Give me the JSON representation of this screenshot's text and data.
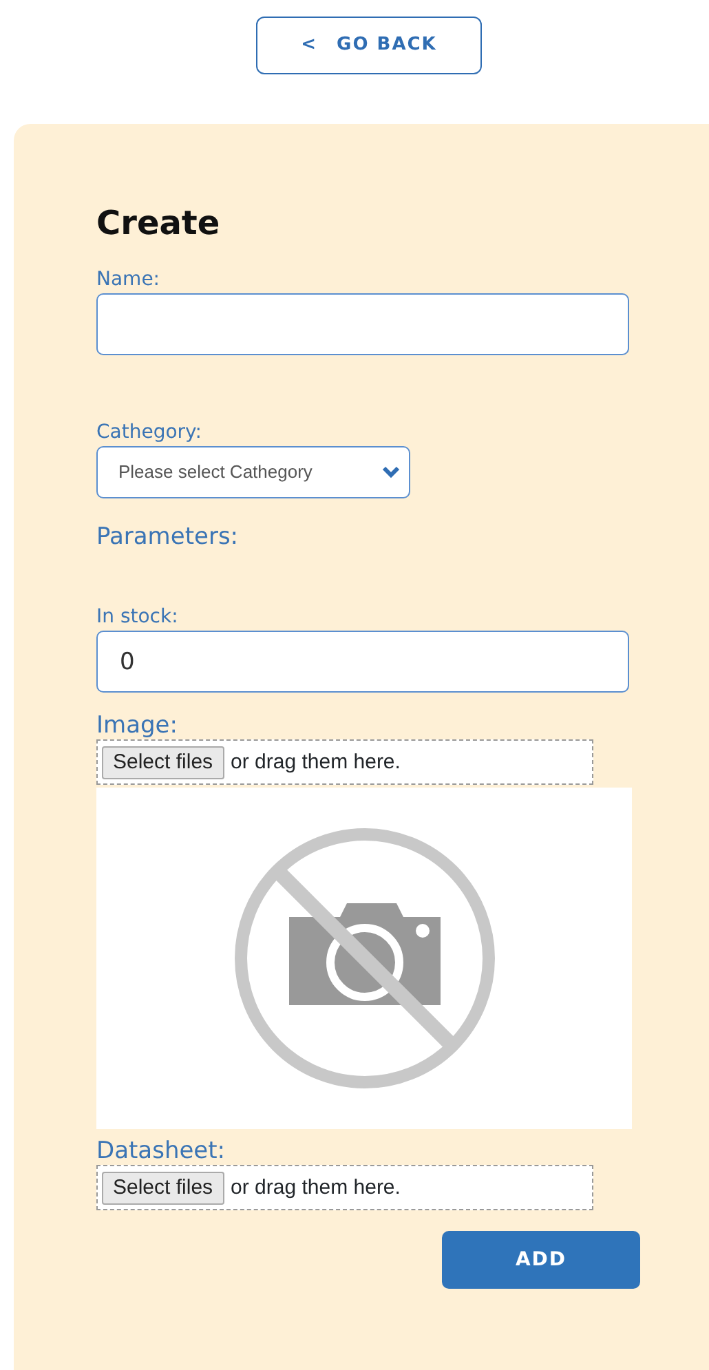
{
  "back_button": {
    "icon": "<",
    "label": "GO BACK"
  },
  "form": {
    "title": "Create",
    "fields": [
      {
        "kind": "text",
        "label": "Name:"
      },
      {
        "kind": "select",
        "label": "Cathegory:",
        "placeholder": "Please select Cathegory"
      },
      {
        "kind": "heading",
        "label": "Parameters:"
      },
      {
        "kind": "text",
        "label": "In stock:",
        "value": "0"
      },
      {
        "kind": "upload",
        "label": "Image:",
        "button": "Select files",
        "hint": "or drag them here.",
        "preview": true
      },
      {
        "kind": "upload",
        "label": "Datasheet:",
        "button": "Select files",
        "hint": "or drag them here."
      }
    ],
    "submit": "ADD"
  }
}
